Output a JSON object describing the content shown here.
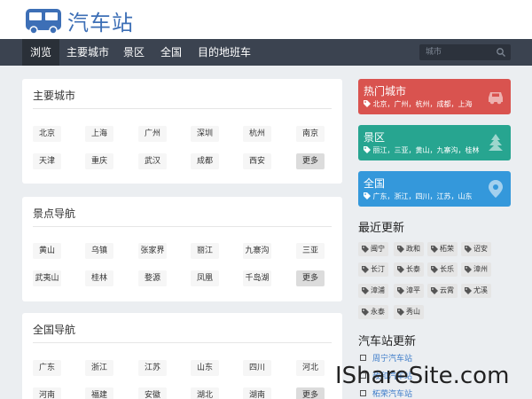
{
  "brand": {
    "title": "汽车站",
    "color": "#3d6fb6"
  },
  "nav": {
    "items": [
      "浏览",
      "主要城市",
      "景区",
      "全国",
      "目的地班车"
    ],
    "active_index": 0,
    "search_placeholder": "城市"
  },
  "panels": {
    "cities": {
      "title": "主要城市",
      "rows": [
        [
          "北京",
          "上海",
          "广州",
          "深圳",
          "杭州",
          "南京"
        ],
        [
          "天津",
          "重庆",
          "武汉",
          "成都",
          "西安",
          "更多"
        ]
      ]
    },
    "scenic": {
      "title": "景点导航",
      "rows": [
        [
          "黄山",
          "乌镇",
          "张家界",
          "丽江",
          "九寨沟",
          "三亚"
        ],
        [
          "武夷山",
          "桂林",
          "婺源",
          "凤凰",
          "千岛湖",
          "更多"
        ]
      ]
    },
    "national": {
      "title": "全国导航",
      "rows": [
        [
          "广东",
          "浙江",
          "江苏",
          "山东",
          "四川",
          "河北"
        ],
        [
          "河南",
          "福建",
          "安徽",
          "湖北",
          "湖南",
          "更多"
        ]
      ]
    }
  },
  "cards": {
    "hot": {
      "title": "热门城市",
      "list": "北京，广州，杭州，成都，上海",
      "color": "#d9534f",
      "icon": "car-icon"
    },
    "scenic": {
      "title": "景区",
      "list": "丽江，三亚，黄山，九寨沟，桂林",
      "color": "#27a590",
      "icon": "tree-icon"
    },
    "national": {
      "title": "全国",
      "list": "广东，浙江，四川，江苏，山东",
      "color": "#3498db",
      "icon": "map-pin-icon"
    }
  },
  "recent": {
    "title": "最近更新",
    "tags": [
      "闽宁",
      "政和",
      "柘荣",
      "诏安",
      "长汀",
      "长泰",
      "长乐",
      "漳州",
      "漳浦",
      "漳平",
      "云霄",
      "尤溪",
      "永泰",
      "秀山"
    ]
  },
  "station_updates": {
    "title": "汽车站更新",
    "items": [
      "周宁汽车站",
      "政和汽车站",
      "柘荣汽车站"
    ]
  },
  "watermark": "IShareSite.com"
}
